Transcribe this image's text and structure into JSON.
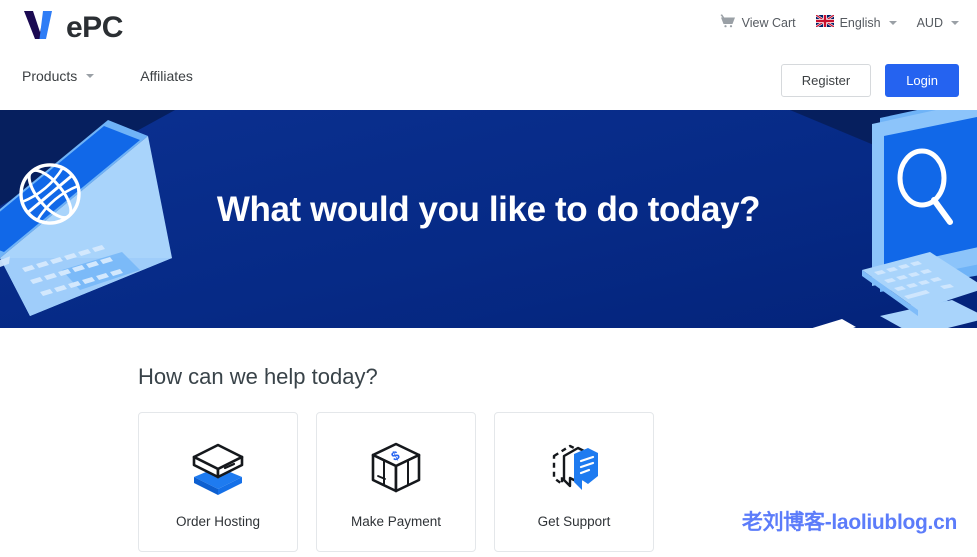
{
  "brand": {
    "name": "WePC",
    "logo_text": "ePC",
    "logo_mark": "w-monogram-icon",
    "colors": {
      "w_dark": "#1b0a52",
      "w_blue": "#2f7df6",
      "wordmark": "#2b2f33"
    }
  },
  "topbar": {
    "cart": {
      "icon": "shopping-cart-icon",
      "label": "View Cart"
    },
    "language": {
      "icon": "uk-flag-icon",
      "label": "English",
      "caret": "chevron-down-icon"
    },
    "currency": {
      "label": "AUD",
      "caret": "chevron-down-icon"
    }
  },
  "nav": {
    "links": [
      {
        "label": "Products",
        "has_caret": true
      },
      {
        "label": "Affiliates",
        "has_caret": false
      }
    ],
    "register_label": "Register",
    "login_label": "Login",
    "accent": "#2563f0"
  },
  "hero": {
    "title": "What would you like to do today?",
    "background": "#062a86",
    "left_art": "isometric-laptop-globe-illustration",
    "right_art": "isometric-desktop-search-illustration"
  },
  "help": {
    "title": "How can we help today?",
    "cards": [
      {
        "label": "Order Hosting",
        "icon": "stacked-layers-icon"
      },
      {
        "label": "Make Payment",
        "icon": "payment-box-dollar-icon"
      },
      {
        "label": "Get Support",
        "icon": "chat-bubbles-icon"
      }
    ]
  },
  "watermark": {
    "text": "老刘博客-laoliublog.cn",
    "color": "#5c7cfa"
  }
}
